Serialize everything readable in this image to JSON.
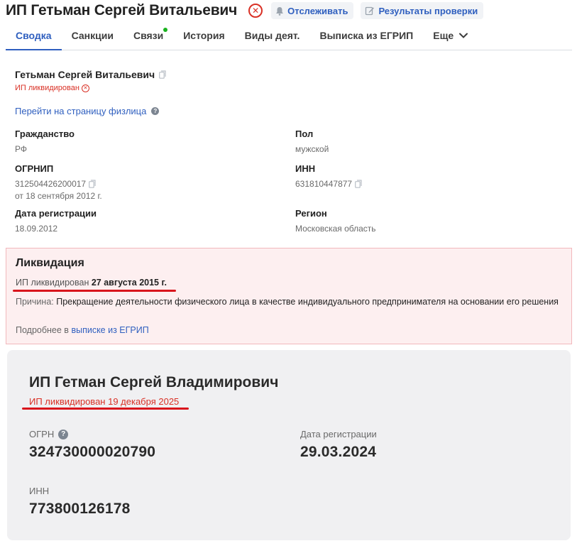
{
  "header": {
    "title": "ИП Гетьман Сергей Витальевич",
    "status_icon": "close-circle-icon",
    "track_label": "Отслеживать",
    "results_label": "Результаты проверки"
  },
  "tabs": [
    {
      "label": "Сводка",
      "active": true
    },
    {
      "label": "Санкции"
    },
    {
      "label": "Связи",
      "indicator": true
    },
    {
      "label": "История"
    },
    {
      "label": "Виды деят."
    },
    {
      "label": "Выписка из ЕГРИП"
    },
    {
      "label": "Еще"
    }
  ],
  "info": {
    "name": "Гетьман Сергей Витальевич",
    "status": "ИП ликвидирован",
    "physical_link": "Перейти на страницу физлица",
    "fields": {
      "citizenship_label": "Гражданство",
      "citizenship_value": "РФ",
      "gender_label": "Пол",
      "gender_value": "мужской",
      "ogrnip_label": "ОГРНИП",
      "ogrnip_value": "312504426200017",
      "ogrnip_date": "от 18 сентября 2012 г.",
      "inn_label": "ИНН",
      "inn_value": "631810447877",
      "regdate_label": "Дата регистрации",
      "regdate_value": "18.09.2012",
      "region_label": "Регион",
      "region_value": "Московская область"
    }
  },
  "liquidation": {
    "title": "Ликвидация",
    "line_prefix": "ИП ликвидирован",
    "line_date": "27 августа 2015 г.",
    "reason_label": "Причина:",
    "reason_text": "Прекращение деятельности физического лица в качестве индивидуального предпринимателя на основании его решения",
    "more_prefix": "Подробнее в",
    "more_link": "выписке из ЕГРИП"
  },
  "card2": {
    "title": "ИП Гетман Сергей Владимирович",
    "status": "ИП ликвидирован 19 декабря 2025",
    "ogrn_label": "ОГРН",
    "ogrn_value": "324730000020790",
    "regdate_label": "Дата регистрации",
    "regdate_value": "29.03.2024",
    "inn_label": "ИНН",
    "inn_value": "773800126178"
  },
  "colors": {
    "accent": "#2f5fbf",
    "danger": "#d93025",
    "marker": "#d9141c",
    "indicator": "#19b21e",
    "liq_bg": "#fdeff0",
    "card2_bg": "#f0f0f2"
  }
}
